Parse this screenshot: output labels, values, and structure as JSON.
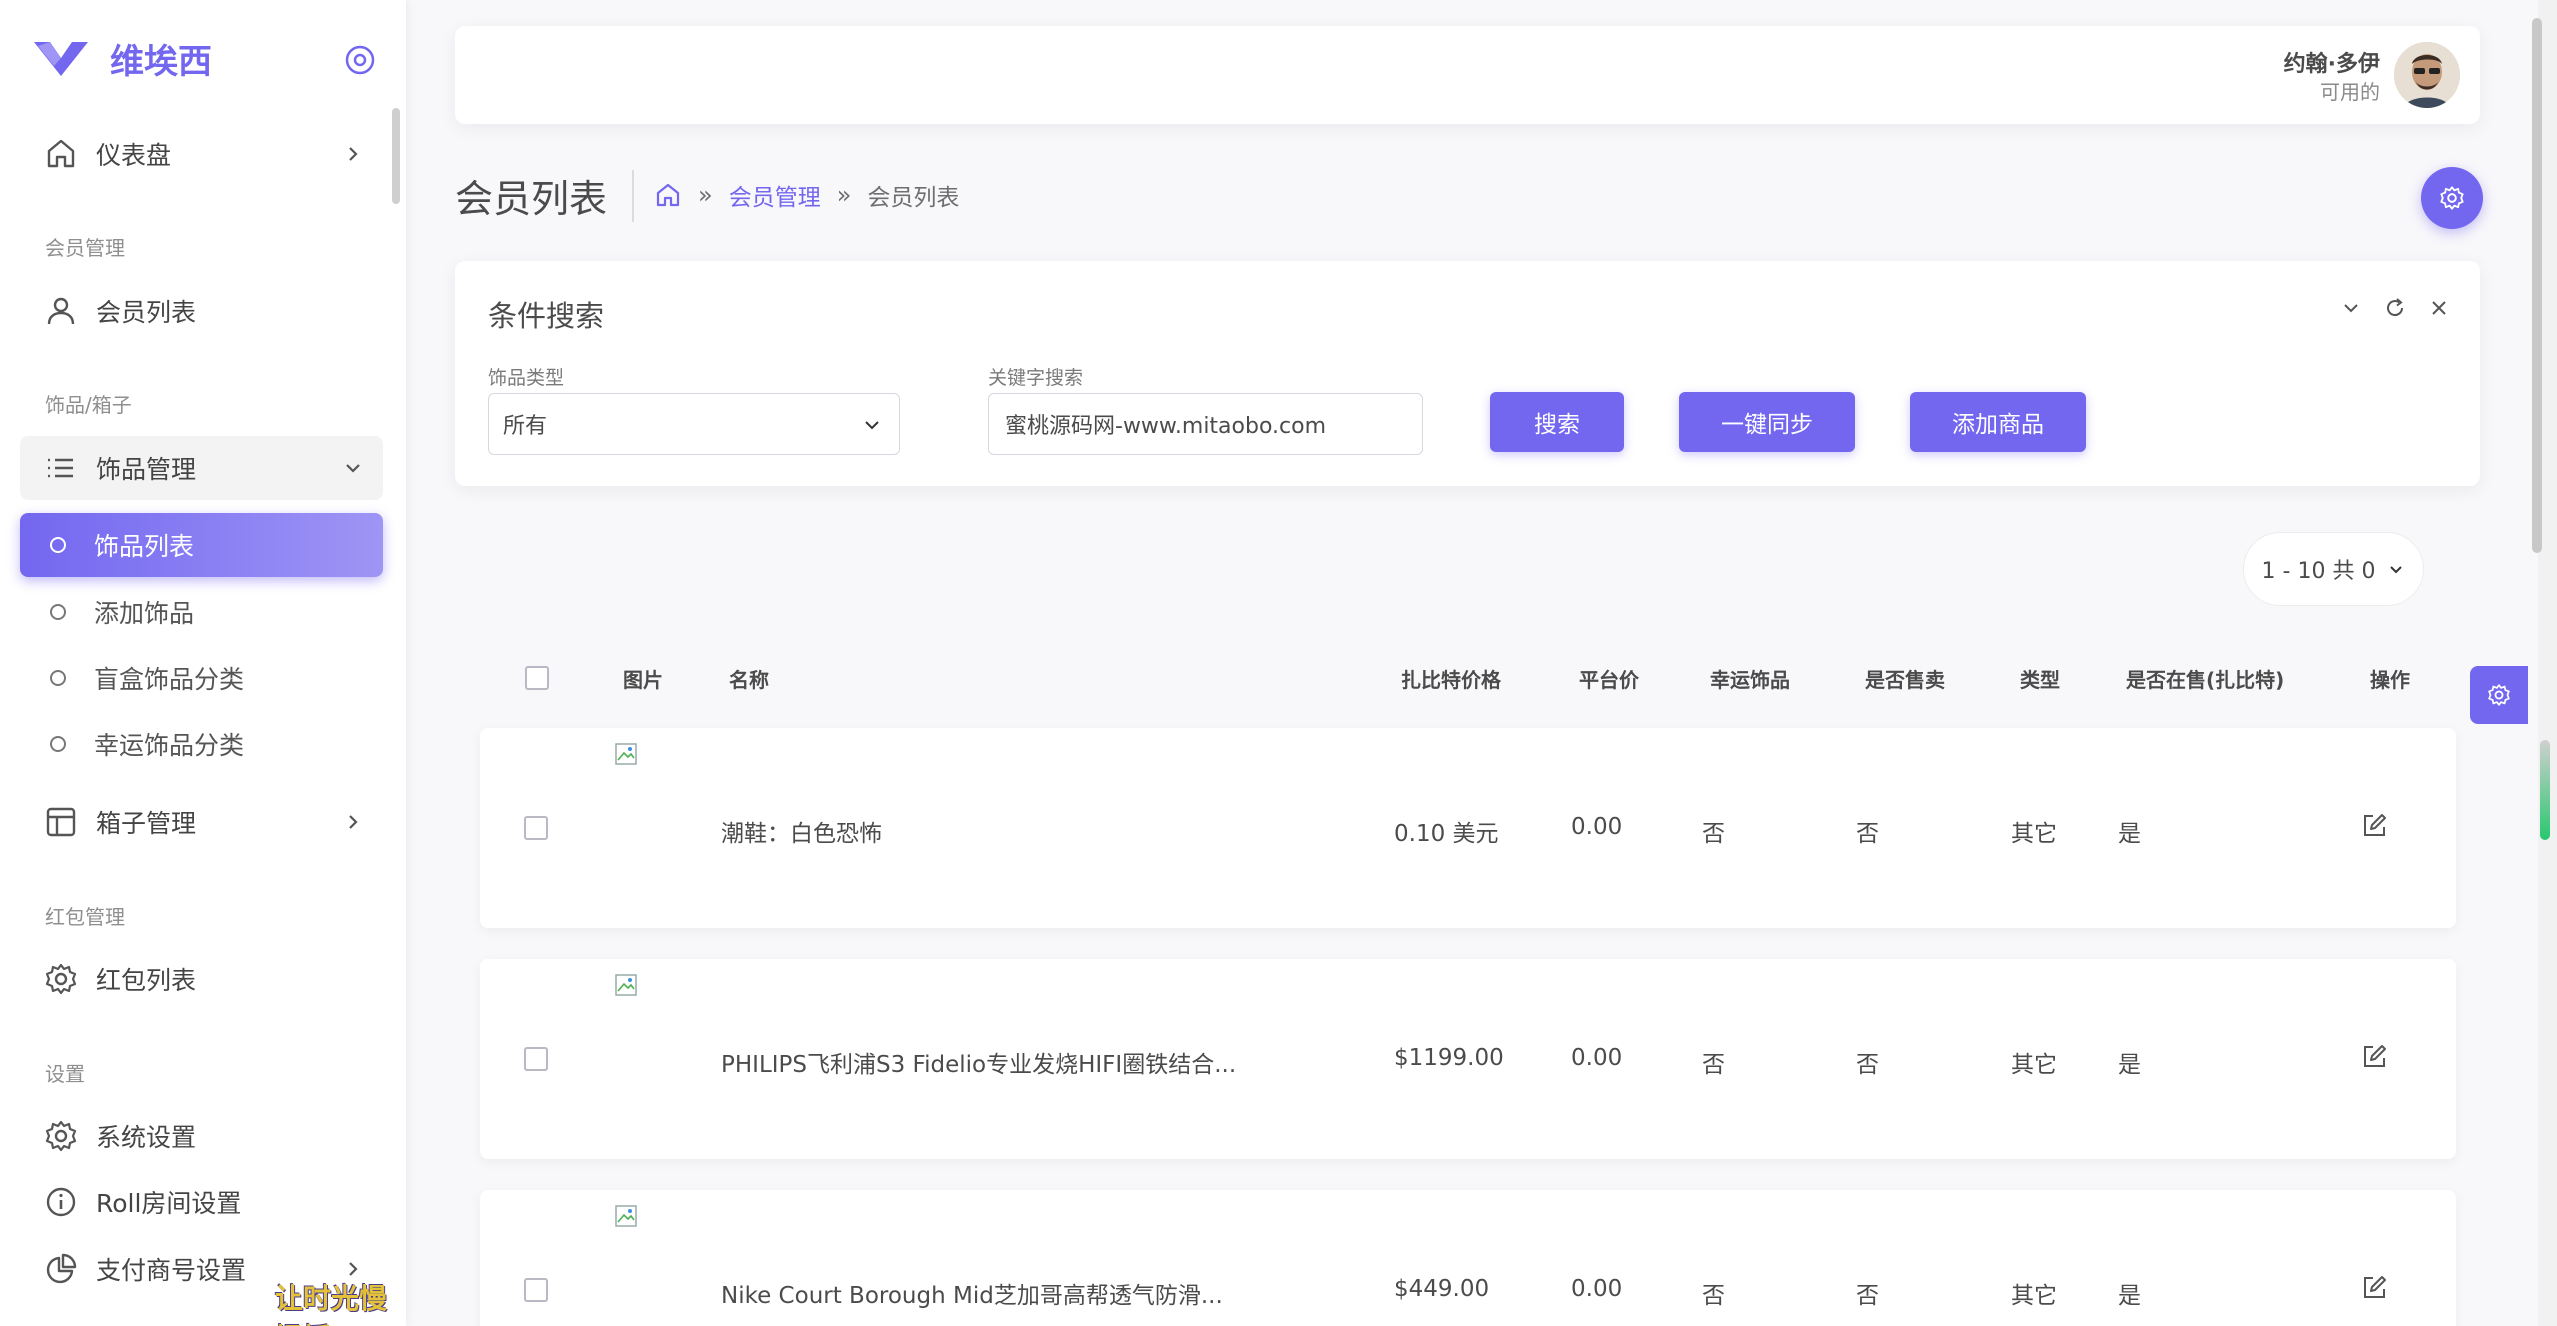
{
  "brand": {
    "name": "维埃西",
    "accent": "#7367f0"
  },
  "sidebar": {
    "dashboard": "仪表盘",
    "section_member": "会员管理",
    "member_list": "会员列表",
    "section_items": "饰品/箱子",
    "item_manage": "饰品管理",
    "item_list": "饰品列表",
    "add_item": "添加饰品",
    "blindbox_category": "盲盒饰品分类",
    "lucky_category": "幸运饰品分类",
    "box_manage": "箱子管理",
    "section_redpack": "红包管理",
    "redpack_list": "红包列表",
    "section_settings": "设置",
    "system_settings": "系统设置",
    "roll_settings": "Roll房间设置",
    "payment_settings": "支付商号设置",
    "watermark": "让时光慢慢摇"
  },
  "user": {
    "name": "约翰·多伊",
    "status": "可用的"
  },
  "page": {
    "title": "会员列表",
    "breadcrumb": {
      "link": "会员管理",
      "current": "会员列表"
    }
  },
  "search": {
    "title": "条件搜索",
    "type_label": "饰品类型",
    "type_value": "所有",
    "keyword_label": "关键字搜索",
    "keyword_value": "蜜桃源码网-www.mitaobo.com",
    "search_button": "搜索",
    "sync_button": "一键同步",
    "add_button": "添加商品"
  },
  "pagination": {
    "label": "1 - 10 共 0"
  },
  "table": {
    "headers": {
      "image": "图片",
      "name": "名称",
      "price": "扎比特价格",
      "platform_price": "平台价",
      "lucky": "幸运饰品",
      "on_sale": "是否售卖",
      "type": "类型",
      "zbt_sale": "是否在售(扎比特)",
      "action": "操作"
    },
    "rows": [
      {
        "name": "潮鞋：白色恐怖",
        "price": "0.10 美元",
        "platform_price": "0.00",
        "lucky": "否",
        "on_sale": "否",
        "type": "其它",
        "zbt_sale": "是"
      },
      {
        "name": "PHILIPS飞利浦S3 Fidelio专业发烧HIFI圈铁结合...",
        "price": "$1199.00",
        "platform_price": "0.00",
        "lucky": "否",
        "on_sale": "否",
        "type": "其它",
        "zbt_sale": "是"
      },
      {
        "name": "Nike Court Borough Mid芝加哥高帮透气防滑...",
        "price": "$449.00",
        "platform_price": "0.00",
        "lucky": "否",
        "on_sale": "否",
        "type": "其它",
        "zbt_sale": "是"
      }
    ]
  }
}
